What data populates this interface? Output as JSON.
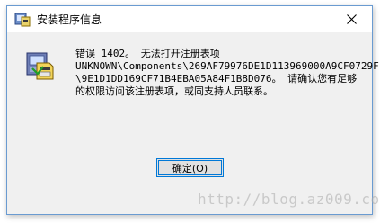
{
  "window": {
    "title": "安装程序信息",
    "title_icon": "installer-icon",
    "close_icon": "close-icon"
  },
  "message": {
    "icon": "installer-package-icon",
    "line1": "错误 1402。 无法打开注册表项",
    "line2": "UNKNOWN\\Components\\269AF79976DE1D113969000A9CF0729F",
    "line3": "\\9E1D1DD169CF71B4EBA05A84F1B8D076。 请确认您有足够",
    "line4": "的权限访问该注册表项，或同支持人员联系。"
  },
  "buttons": {
    "ok_label": "确定(O)"
  },
  "watermark": {
    "text": "http://blog.az009.com"
  }
}
